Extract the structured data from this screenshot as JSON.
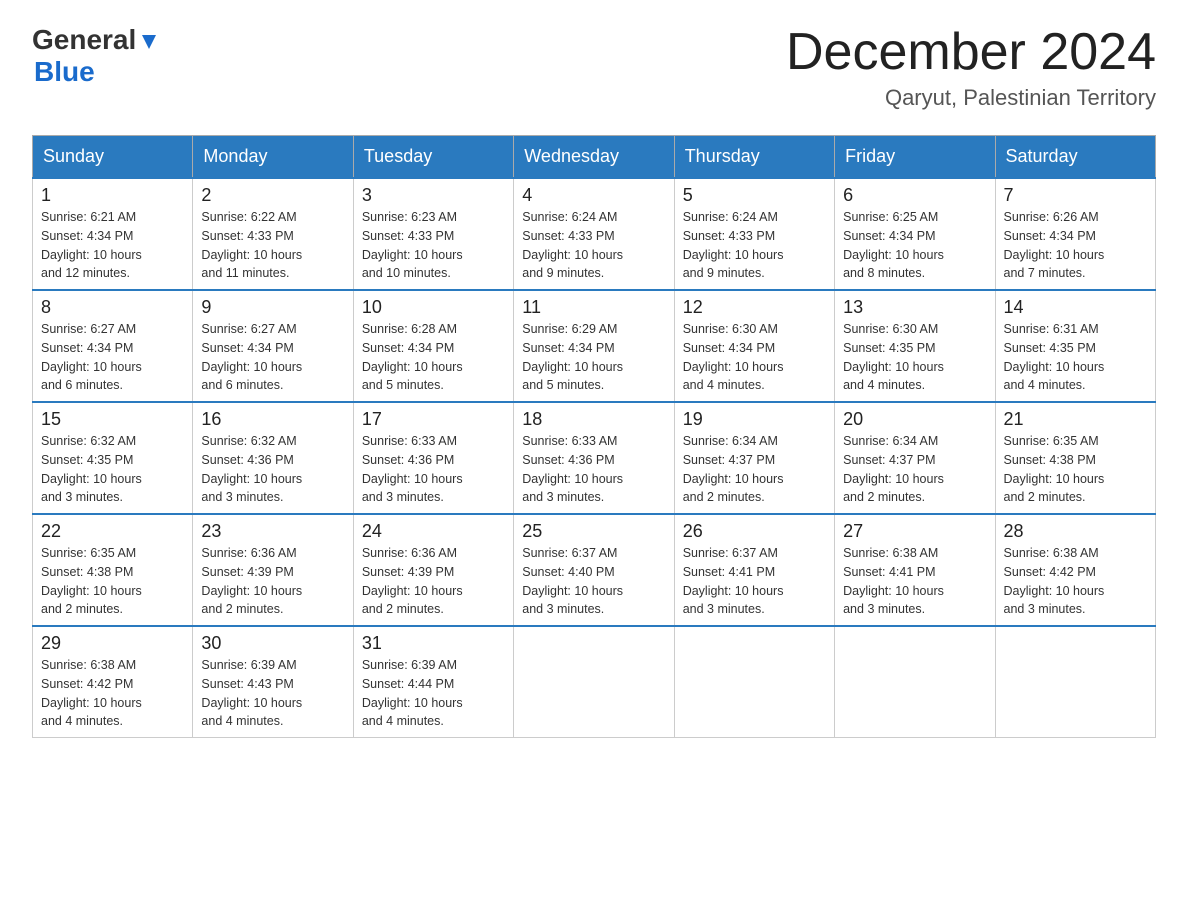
{
  "header": {
    "logo_general": "General",
    "logo_blue": "Blue",
    "month_title": "December 2024",
    "subtitle": "Qaryut, Palestinian Territory"
  },
  "days_of_week": [
    "Sunday",
    "Monday",
    "Tuesday",
    "Wednesday",
    "Thursday",
    "Friday",
    "Saturday"
  ],
  "weeks": [
    [
      {
        "day": "1",
        "sunrise": "6:21 AM",
        "sunset": "4:34 PM",
        "daylight": "10 hours and 12 minutes."
      },
      {
        "day": "2",
        "sunrise": "6:22 AM",
        "sunset": "4:33 PM",
        "daylight": "10 hours and 11 minutes."
      },
      {
        "day": "3",
        "sunrise": "6:23 AM",
        "sunset": "4:33 PM",
        "daylight": "10 hours and 10 minutes."
      },
      {
        "day": "4",
        "sunrise": "6:24 AM",
        "sunset": "4:33 PM",
        "daylight": "10 hours and 9 minutes."
      },
      {
        "day": "5",
        "sunrise": "6:24 AM",
        "sunset": "4:33 PM",
        "daylight": "10 hours and 9 minutes."
      },
      {
        "day": "6",
        "sunrise": "6:25 AM",
        "sunset": "4:34 PM",
        "daylight": "10 hours and 8 minutes."
      },
      {
        "day": "7",
        "sunrise": "6:26 AM",
        "sunset": "4:34 PM",
        "daylight": "10 hours and 7 minutes."
      }
    ],
    [
      {
        "day": "8",
        "sunrise": "6:27 AM",
        "sunset": "4:34 PM",
        "daylight": "10 hours and 6 minutes."
      },
      {
        "day": "9",
        "sunrise": "6:27 AM",
        "sunset": "4:34 PM",
        "daylight": "10 hours and 6 minutes."
      },
      {
        "day": "10",
        "sunrise": "6:28 AM",
        "sunset": "4:34 PM",
        "daylight": "10 hours and 5 minutes."
      },
      {
        "day": "11",
        "sunrise": "6:29 AM",
        "sunset": "4:34 PM",
        "daylight": "10 hours and 5 minutes."
      },
      {
        "day": "12",
        "sunrise": "6:30 AM",
        "sunset": "4:34 PM",
        "daylight": "10 hours and 4 minutes."
      },
      {
        "day": "13",
        "sunrise": "6:30 AM",
        "sunset": "4:35 PM",
        "daylight": "10 hours and 4 minutes."
      },
      {
        "day": "14",
        "sunrise": "6:31 AM",
        "sunset": "4:35 PM",
        "daylight": "10 hours and 4 minutes."
      }
    ],
    [
      {
        "day": "15",
        "sunrise": "6:32 AM",
        "sunset": "4:35 PM",
        "daylight": "10 hours and 3 minutes."
      },
      {
        "day": "16",
        "sunrise": "6:32 AM",
        "sunset": "4:36 PM",
        "daylight": "10 hours and 3 minutes."
      },
      {
        "day": "17",
        "sunrise": "6:33 AM",
        "sunset": "4:36 PM",
        "daylight": "10 hours and 3 minutes."
      },
      {
        "day": "18",
        "sunrise": "6:33 AM",
        "sunset": "4:36 PM",
        "daylight": "10 hours and 3 minutes."
      },
      {
        "day": "19",
        "sunrise": "6:34 AM",
        "sunset": "4:37 PM",
        "daylight": "10 hours and 2 minutes."
      },
      {
        "day": "20",
        "sunrise": "6:34 AM",
        "sunset": "4:37 PM",
        "daylight": "10 hours and 2 minutes."
      },
      {
        "day": "21",
        "sunrise": "6:35 AM",
        "sunset": "4:38 PM",
        "daylight": "10 hours and 2 minutes."
      }
    ],
    [
      {
        "day": "22",
        "sunrise": "6:35 AM",
        "sunset": "4:38 PM",
        "daylight": "10 hours and 2 minutes."
      },
      {
        "day": "23",
        "sunrise": "6:36 AM",
        "sunset": "4:39 PM",
        "daylight": "10 hours and 2 minutes."
      },
      {
        "day": "24",
        "sunrise": "6:36 AM",
        "sunset": "4:39 PM",
        "daylight": "10 hours and 2 minutes."
      },
      {
        "day": "25",
        "sunrise": "6:37 AM",
        "sunset": "4:40 PM",
        "daylight": "10 hours and 3 minutes."
      },
      {
        "day": "26",
        "sunrise": "6:37 AM",
        "sunset": "4:41 PM",
        "daylight": "10 hours and 3 minutes."
      },
      {
        "day": "27",
        "sunrise": "6:38 AM",
        "sunset": "4:41 PM",
        "daylight": "10 hours and 3 minutes."
      },
      {
        "day": "28",
        "sunrise": "6:38 AM",
        "sunset": "4:42 PM",
        "daylight": "10 hours and 3 minutes."
      }
    ],
    [
      {
        "day": "29",
        "sunrise": "6:38 AM",
        "sunset": "4:42 PM",
        "daylight": "10 hours and 4 minutes."
      },
      {
        "day": "30",
        "sunrise": "6:39 AM",
        "sunset": "4:43 PM",
        "daylight": "10 hours and 4 minutes."
      },
      {
        "day": "31",
        "sunrise": "6:39 AM",
        "sunset": "4:44 PM",
        "daylight": "10 hours and 4 minutes."
      },
      null,
      null,
      null,
      null
    ]
  ],
  "labels": {
    "sunrise": "Sunrise:",
    "sunset": "Sunset:",
    "daylight": "Daylight:"
  }
}
